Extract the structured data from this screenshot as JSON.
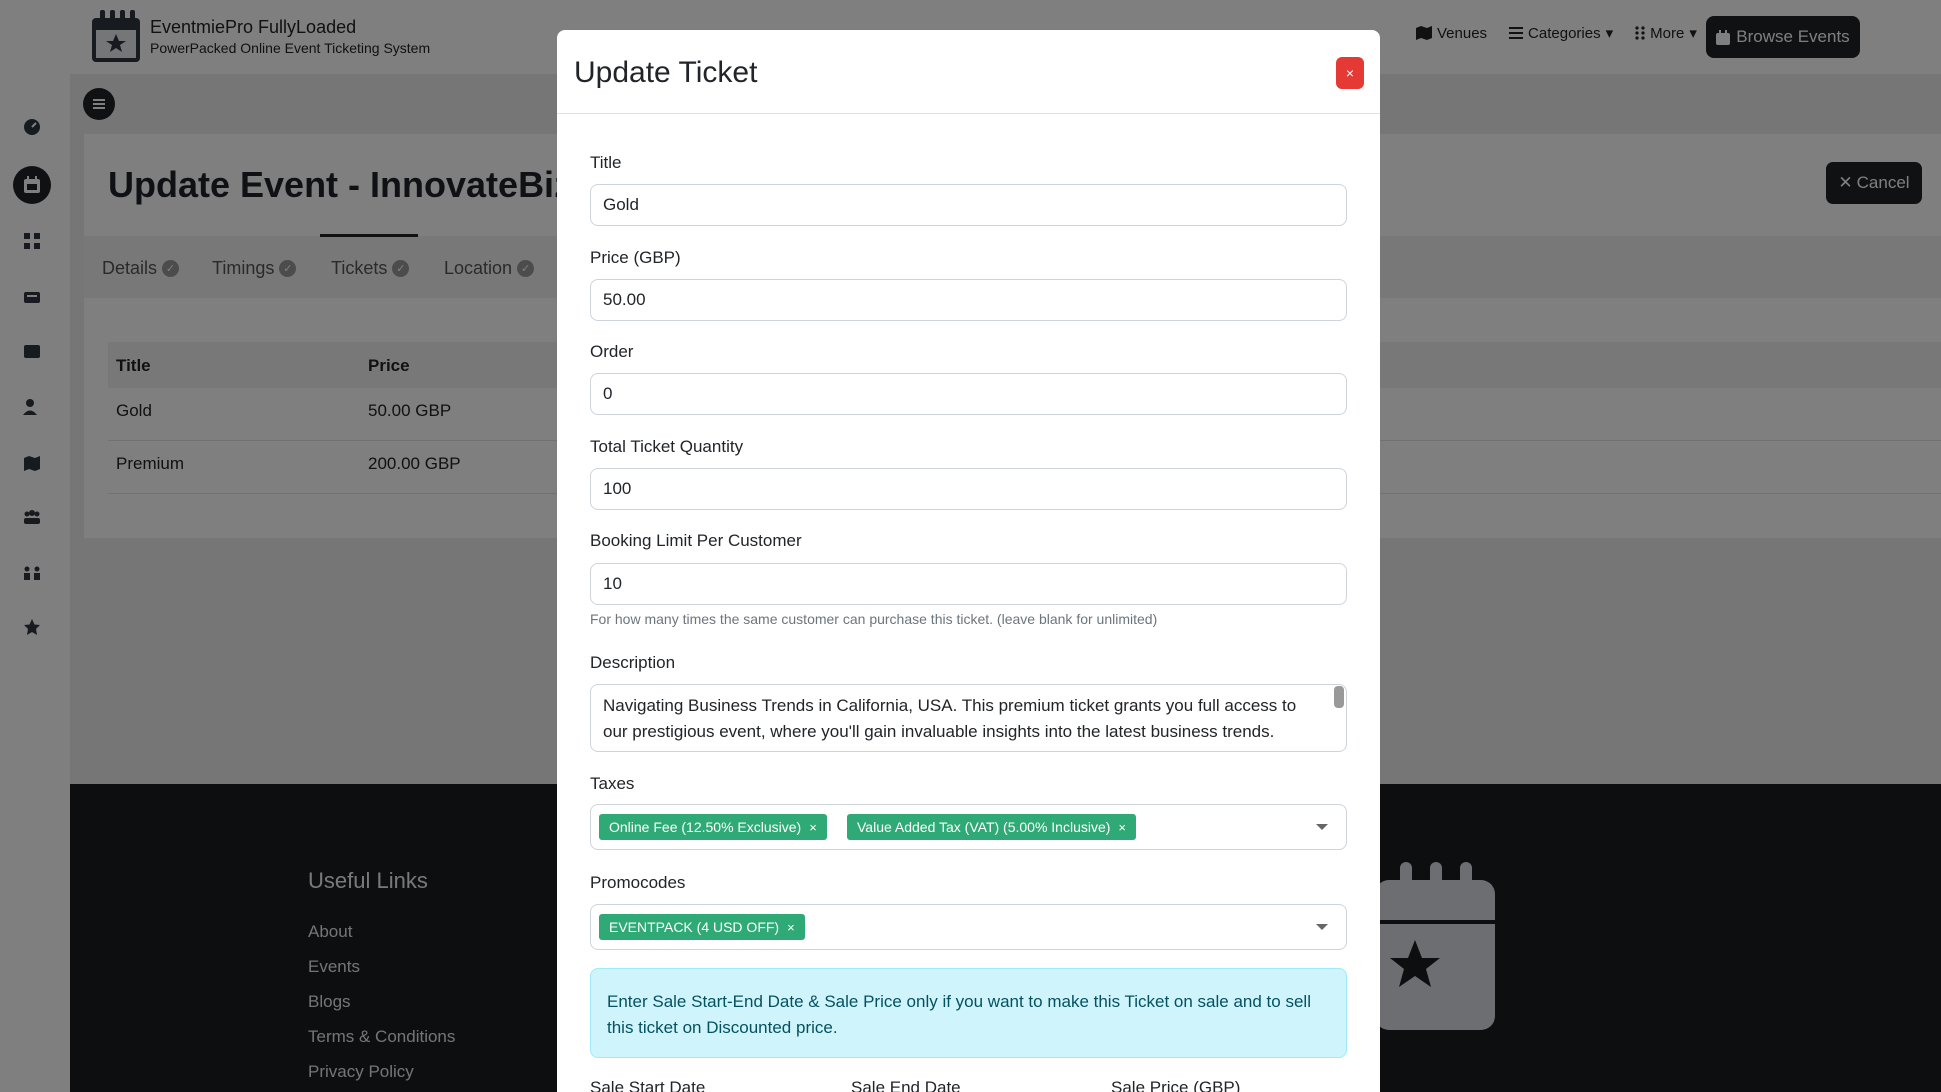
{
  "header": {
    "brand_name": "EventmiePro FullyLoaded",
    "brand_tagline": "PowerPacked Online Event Ticketing System",
    "nav": [
      {
        "label": "Venues",
        "icon": "map-icon"
      },
      {
        "label": "Categories",
        "icon": "list-icon"
      },
      {
        "label": "More",
        "icon": "grid-icon"
      }
    ],
    "browse_label": "Browse Events"
  },
  "page": {
    "title": "Update Event - InnovateBiz Su",
    "cancel_label": "Cancel",
    "tabs": [
      {
        "label": "Details"
      },
      {
        "label": "Timings"
      },
      {
        "label": "Tickets"
      },
      {
        "label": "Location"
      }
    ],
    "table": {
      "headers": [
        "Title",
        "Price"
      ],
      "rows": [
        [
          "Gold",
          "50.00 GBP"
        ],
        [
          "Premium",
          "200.00 GBP"
        ]
      ]
    }
  },
  "footer": {
    "title": "Useful Links",
    "links": [
      "About",
      "Events",
      "Blogs",
      "Terms & Conditions",
      "Privacy Policy"
    ]
  },
  "modal": {
    "title": "Update Ticket",
    "close_label": "×",
    "fields": {
      "title_label": "Title",
      "title_value": "Gold",
      "price_label": "Price (GBP)",
      "price_value": "50.00",
      "order_label": "Order",
      "order_value": "0",
      "quantity_label": "Total Ticket Quantity",
      "quantity_value": "100",
      "limit_label": "Booking Limit Per Customer",
      "limit_value": "10",
      "limit_help": "For how many times the same customer can purchase this ticket. (leave blank for unlimited)",
      "description_label": "Description",
      "description_value": "Navigating Business Trends in California, USA. This premium ticket grants you full access to our prestigious event, where you'll gain invaluable insights into the latest business trends. Network",
      "taxes_label": "Taxes",
      "taxes": [
        "Online Fee (12.50% Exclusive)",
        "Value Added Tax (VAT) (5.00% Inclusive)"
      ],
      "promocodes_label": "Promocodes",
      "promocodes": [
        "EVENTPACK (4 USD OFF)"
      ],
      "sale_info": "Enter Sale Start-End Date & Sale Price only if you want to make this Ticket on sale and to sell this ticket on Discounted price.",
      "sale_start_label": "Sale Start Date",
      "sale_end_label": "Sale End Date",
      "sale_price_label": "Sale Price (GBP)"
    }
  },
  "colors": {
    "dark": "#1f2327",
    "chip_green": "#2faa76",
    "close_red": "#e53935",
    "info_bg": "#cff4fc",
    "info_text": "#055160"
  }
}
